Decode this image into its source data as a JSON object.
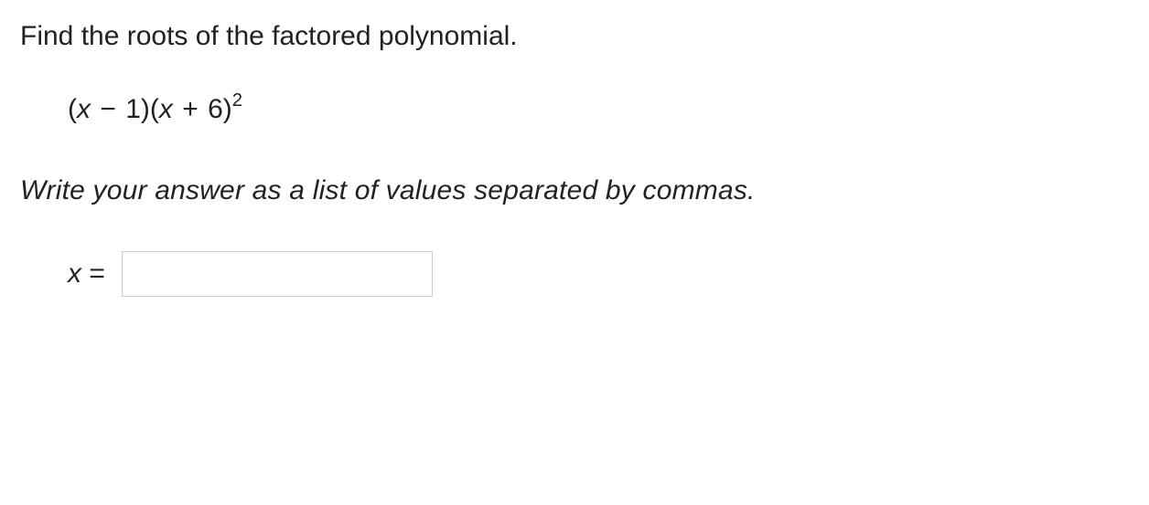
{
  "question": "Find the roots of the factored polynomial.",
  "expression": {
    "part1": "(",
    "var1": "x",
    "minus": " − ",
    "num1": "1)(",
    "var2": "x",
    "plus": " + ",
    "num2": "6)",
    "exponent": "2"
  },
  "hint": "Write your answer as a list of values separated by commas.",
  "answer": {
    "label_var": "x",
    "label_eq": " = ",
    "value": ""
  }
}
